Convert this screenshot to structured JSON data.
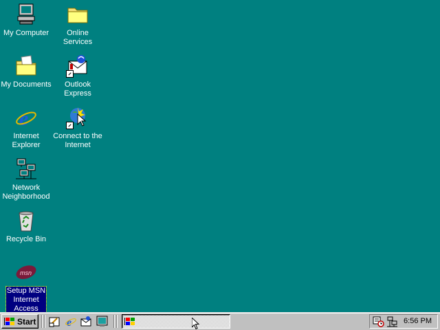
{
  "desktop": {
    "background_color": "#008080",
    "icons": [
      {
        "label": "My Computer",
        "icon": "computer-icon"
      },
      {
        "label": "Online\nServices",
        "icon": "folder-icon"
      },
      {
        "label": "My Documents",
        "icon": "documents-folder-icon"
      },
      {
        "label": "Outlook\nExpress",
        "icon": "outlook-express-icon"
      },
      {
        "label": "Internet\nExplorer",
        "icon": "internet-explorer-icon"
      },
      {
        "label": "Connect to the\nInternet",
        "icon": "connect-wizard-icon"
      },
      {
        "label": "Network\nNeighborhood",
        "icon": "network-icon"
      },
      {
        "label": "Recycle Bin",
        "icon": "recycle-bin-icon"
      },
      {
        "label": "Setup MSN\nInternet\nAccess",
        "icon": "msn-icon"
      }
    ]
  },
  "taskbar": {
    "start_label": "Start",
    "quick_launch": [
      "show-desktop-icon",
      "internet-explorer-icon",
      "outlook-express-icon",
      "channels-icon"
    ],
    "tray": {
      "icons": [
        "scheduler-icon",
        "network-tray-icon"
      ],
      "clock": "6:56 PM"
    }
  }
}
